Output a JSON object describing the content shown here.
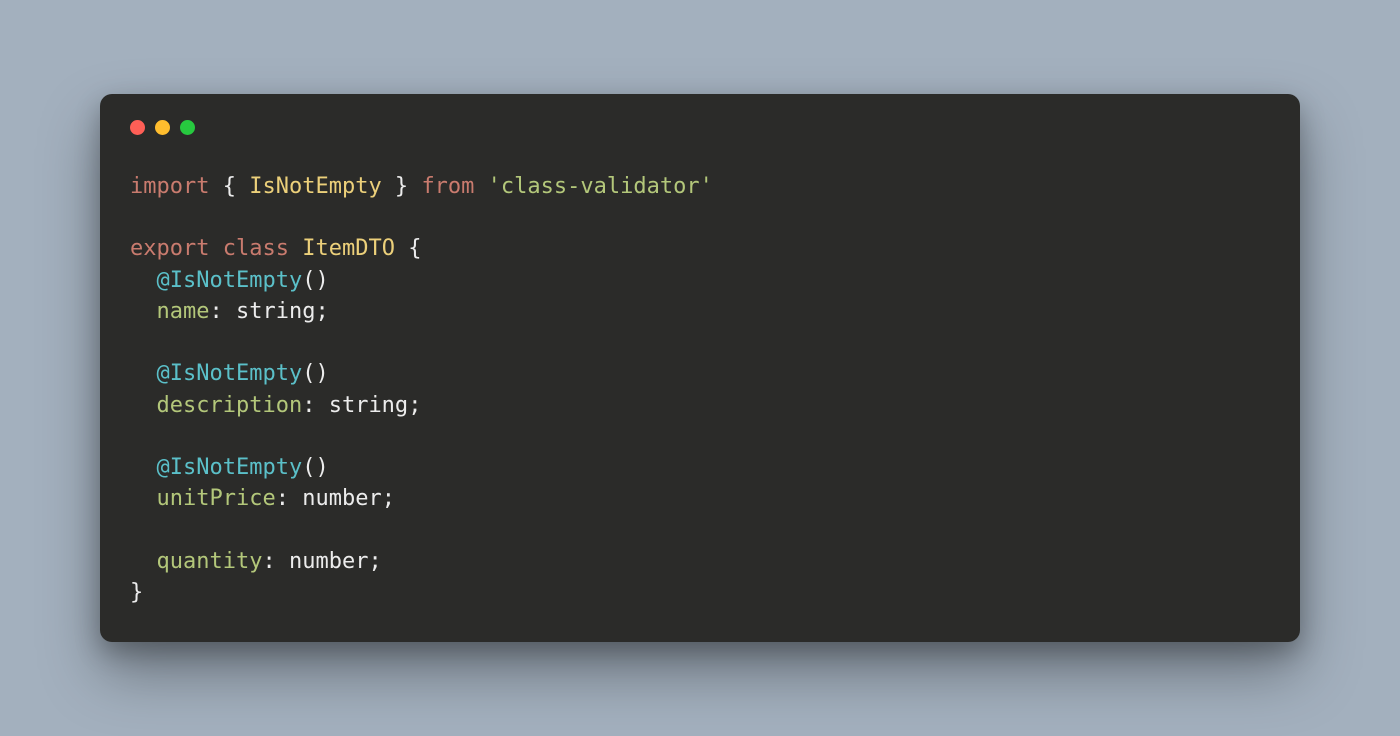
{
  "code": {
    "kw_import": "import",
    "kw_from": "from",
    "kw_export": "export",
    "kw_class": "class",
    "identifier_IsNotEmpty": "IsNotEmpty",
    "class_name": "ItemDTO",
    "module_string": "'class-validator'",
    "decorator": "@IsNotEmpty",
    "parens": "()",
    "open_brace": "{",
    "close_brace": "}",
    "open_brace_sp": "{ ",
    "close_brace_sp": " }",
    "colon_space": ": ",
    "semicolon": ";",
    "indent": "  ",
    "fields": {
      "name": {
        "name": "name",
        "type": "string"
      },
      "description": {
        "name": "description",
        "type": "string"
      },
      "unitPrice": {
        "name": "unitPrice",
        "type": "number"
      },
      "quantity": {
        "name": "quantity",
        "type": "number"
      }
    }
  }
}
